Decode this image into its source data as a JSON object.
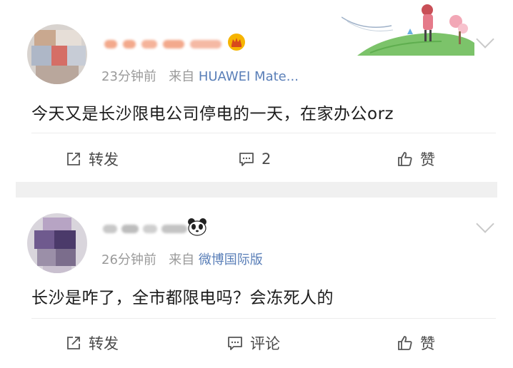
{
  "posts": [
    {
      "time": "23分钟前",
      "from_prefix": "来自",
      "source": "HUAWEI Mate...",
      "content": "今天又是长沙限电公司停电的一天，在家办公orz",
      "actions": {
        "repost": "转发",
        "comment": "2",
        "like": "赞"
      }
    },
    {
      "time": "26分钟前",
      "from_prefix": "来自",
      "source": "微博国际版",
      "content": "长沙是咋了，全市都限电吗？会冻死人的",
      "actions": {
        "repost": "转发",
        "comment": "评论",
        "like": "赞"
      }
    }
  ],
  "icons": {
    "repost": "repost-icon",
    "comment": "comment-icon",
    "like": "thumbs-up-icon",
    "more": "chevron-down-icon",
    "badge1": "crown-badge-icon",
    "badge2": "panda-icon"
  },
  "colors": {
    "source_link": "#5a7fb8",
    "meta": "#9a9a9a",
    "separator": "#f0f0f0"
  }
}
